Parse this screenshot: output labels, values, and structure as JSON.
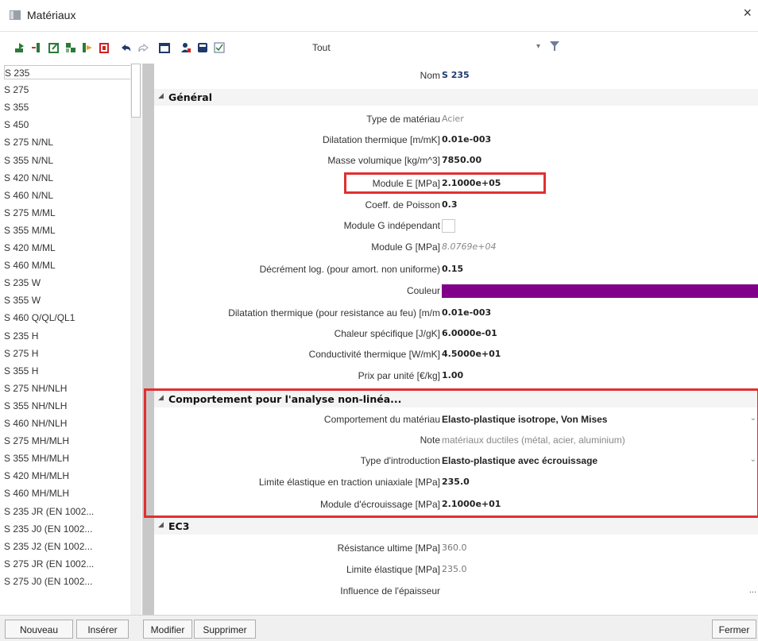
{
  "window": {
    "title": "Matériaux",
    "close_glyph": "×"
  },
  "toolbar": {
    "icons": [
      "import-icon",
      "insert-icon",
      "edit-icon",
      "copy-icon",
      "export-icon",
      "delete-icon",
      "undo-icon",
      "redo-icon",
      "clear-icon",
      "user-icon",
      "save-icon",
      "checklist-icon"
    ],
    "filter_label": "Tout",
    "filter_arrow": "▾",
    "funnel": "▼"
  },
  "materials": [
    "S 235",
    "S 275",
    "S 355",
    "S 450",
    "S 275 N/NL",
    "S 355 N/NL",
    "S 420 N/NL",
    "S 460 N/NL",
    "S 275 M/ML",
    "S 355 M/ML",
    "S 420 M/ML",
    "S 460 M/ML",
    "S 235 W",
    "S 355 W",
    "S 460 Q/QL/QL1",
    "S 235 H",
    "S 275 H",
    "S 355 H",
    "S 275 NH/NLH",
    "S 355 NH/NLH",
    "S 460 NH/NLH",
    "S 275 MH/MLH",
    "S 355 MH/MLH",
    "S 420 MH/MLH",
    "S 460 MH/MLH",
    "S 235 JR (EN 1002...",
    "S 235 J0 (EN 1002...",
    "S 235 J2 (EN 1002...",
    "S 275 JR (EN 1002...",
    "S 275 J0 (EN 1002..."
  ],
  "props": {
    "nom_label": "Nom",
    "nom_value": "S 235",
    "general": "Général",
    "type_label": "Type de matériau",
    "type_value": "Acier",
    "dil_label": "Dilatation thermique  [m/mK]",
    "dil_value": "0.01e-003",
    "masse_label": "Masse volumique [kg/m^3]",
    "masse_value": "7850.00",
    "modE_label": "Module E [MPa]",
    "modE_value": "2.1000e+05",
    "poisson_label": "Coeff. de Poisson",
    "poisson_value": "0.3",
    "modGind_label": "Module G indépendant",
    "modG_label": "Module G [MPa]",
    "modG_value": "8.0769e+04",
    "decr_label": "Décrément log. (pour amort. non uniforme)",
    "decr_value": "0.15",
    "couleur_label": "Couleur",
    "couleur_color": "#80008a",
    "dilfeu_label": "Dilatation thermique (pour resistance au feu)  [m/m",
    "dilfeu_value": "0.01e-003",
    "chal_label": "Chaleur spécifique [J/gK]",
    "chal_value": "6.0000e-01",
    "cond_label": "Conductivité thermique [W/mK]",
    "cond_value": "4.5000e+01",
    "prix_label": "Prix par unité [€/kg]",
    "prix_value": "1.00",
    "nonlin": "Comportement pour l'analyse non-linéa...",
    "comp_label": "Comportement du matériau",
    "comp_value": "Elasto-plastique isotrope, Von Mises",
    "note_label": "Note",
    "note_value": "matériaux ductiles (métal, acier, aluminium)",
    "intro_label": "Type d'introduction",
    "intro_value": "Elasto-plastique avec écrouissage",
    "lim_label": "Limite élastique en traction uniaxiale [MPa]",
    "lim_value": "235.0",
    "ecr_label": "Module d'écrouissage [MPa]",
    "ecr_value": "2.1000e+01",
    "ec3": "EC3",
    "res_label": "Résistance ultime [MPa]",
    "res_value": "360.0",
    "limE_label": "Limite élastique [MPa]",
    "limE_value": "235.0",
    "infl_label": "Influence de l'épaisseur",
    "infl_value": "..."
  },
  "buttons": {
    "nouveau": "Nouveau",
    "inserer": "Insérer",
    "modifier": "Modifier",
    "supprimer": "Supprimer",
    "fermer": "Fermer"
  }
}
